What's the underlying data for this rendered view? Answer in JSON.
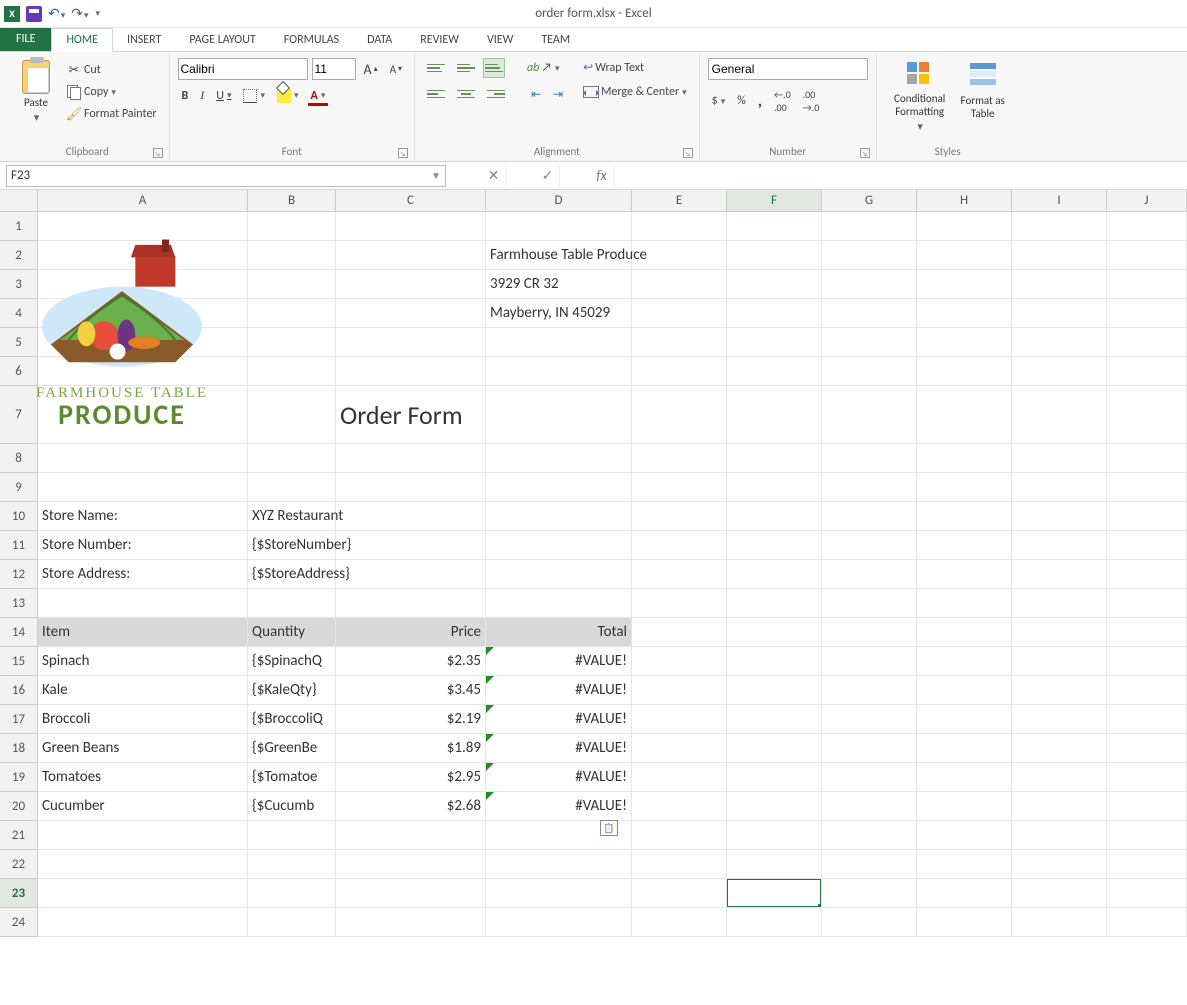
{
  "titlebar": {
    "doc_title": "order form.xlsx - Excel"
  },
  "tabs": {
    "file": "FILE",
    "home": "HOME",
    "insert": "INSERT",
    "page_layout": "PAGE LAYOUT",
    "formulas": "FORMULAS",
    "data": "DATA",
    "review": "REVIEW",
    "view": "VIEW",
    "team": "TEAM"
  },
  "ribbon": {
    "clipboard": {
      "paste": "Paste",
      "cut": "Cut",
      "copy": "Copy",
      "format_painter": "Format Painter",
      "label": "Clipboard"
    },
    "font": {
      "name": "Calibri",
      "size": "11",
      "label": "Font"
    },
    "alignment": {
      "wrap": "Wrap Text",
      "merge": "Merge & Center",
      "label": "Alignment"
    },
    "number": {
      "format": "General",
      "label": "Number"
    },
    "styles": {
      "cond": "Conditional Formatting",
      "table": "Format as Table",
      "label": "Styles"
    }
  },
  "namebox": "F23",
  "columns": [
    "A",
    "B",
    "C",
    "D",
    "E",
    "F",
    "G",
    "H",
    "I",
    "J"
  ],
  "rows": [
    "1",
    "2",
    "3",
    "4",
    "5",
    "6",
    "7",
    "8",
    "9",
    "10",
    "11",
    "12",
    "13",
    "14",
    "15",
    "16",
    "17",
    "18",
    "19",
    "20",
    "21",
    "22",
    "23",
    "24"
  ],
  "cells": {
    "D2": "Farmhouse Table Produce",
    "D3": "3929 CR 32",
    "D4": "Mayberry, IN 45029",
    "C7": "Order Form",
    "A10": "Store Name:",
    "B10": "XYZ Restaurant",
    "A11": "Store Number:",
    "B11": "{$StoreNumber}",
    "A12": "Store Address:",
    "B12": "{$StoreAddress}",
    "H14_item": "Item",
    "H14_qty": "Quantity",
    "H14_price": "Price",
    "H14_total": "Total",
    "items": [
      {
        "name": "Spinach",
        "qty": "{$SpinachQ",
        "price": "$2.35",
        "total": "#VALUE!"
      },
      {
        "name": "Kale",
        "qty": "{$KaleQty}",
        "price": "$3.45",
        "total": "#VALUE!"
      },
      {
        "name": "Broccoli",
        "qty": "{$BroccoliQ",
        "price": "$2.19",
        "total": "#VALUE!"
      },
      {
        "name": "Green Beans",
        "qty": "{$GreenBe",
        "price": "$1.89",
        "total": "#VALUE!"
      },
      {
        "name": "Tomatoes",
        "qty": "{$Tomatoe",
        "price": "$2.95",
        "total": "#VALUE!"
      },
      {
        "name": "Cucumber",
        "qty": "{$Cucumb",
        "price": "$2.68",
        "total": "#VALUE!"
      }
    ]
  },
  "logo": {
    "line1": "FARMHOUSE TABLE",
    "line2": "PRODUCE"
  }
}
